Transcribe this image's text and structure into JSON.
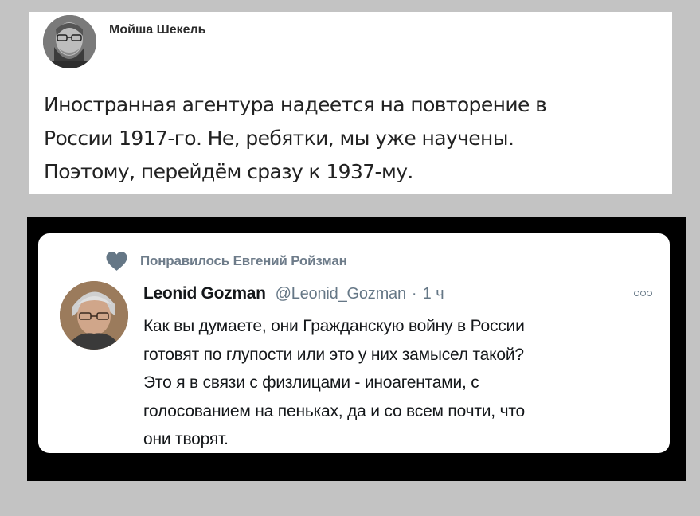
{
  "post_top": {
    "author": "Мойша Шекель",
    "text_lines": [
      "Иностранная агентура надеется на повторение в",
      "России 1917-го. Не, ребятки, мы уже научены.",
      "Поэтому, перейдём сразу к 1937-му."
    ]
  },
  "tweet": {
    "liked_by": "Понравилось Евгений Ройзман",
    "display_name": "Leonid Gozman",
    "handle": "@Leonid_Gozman",
    "separator": "·",
    "time": "1 ч",
    "text_lines": [
      "Как вы думаете, они Гражданскую войну в России",
      "готовят по глупости или это у них замысел такой?",
      "Это я в связи с физлицами - иноагентами, с",
      "голосованием на пеньках, да и со всем почти, что",
      "они творят."
    ]
  },
  "colors": {
    "background": "#c3c3c3",
    "frame": "#000000",
    "secondary_text": "#657786",
    "heart": "#657786"
  },
  "icons": {
    "heart": "heart-icon",
    "more": "more-options-icon"
  }
}
